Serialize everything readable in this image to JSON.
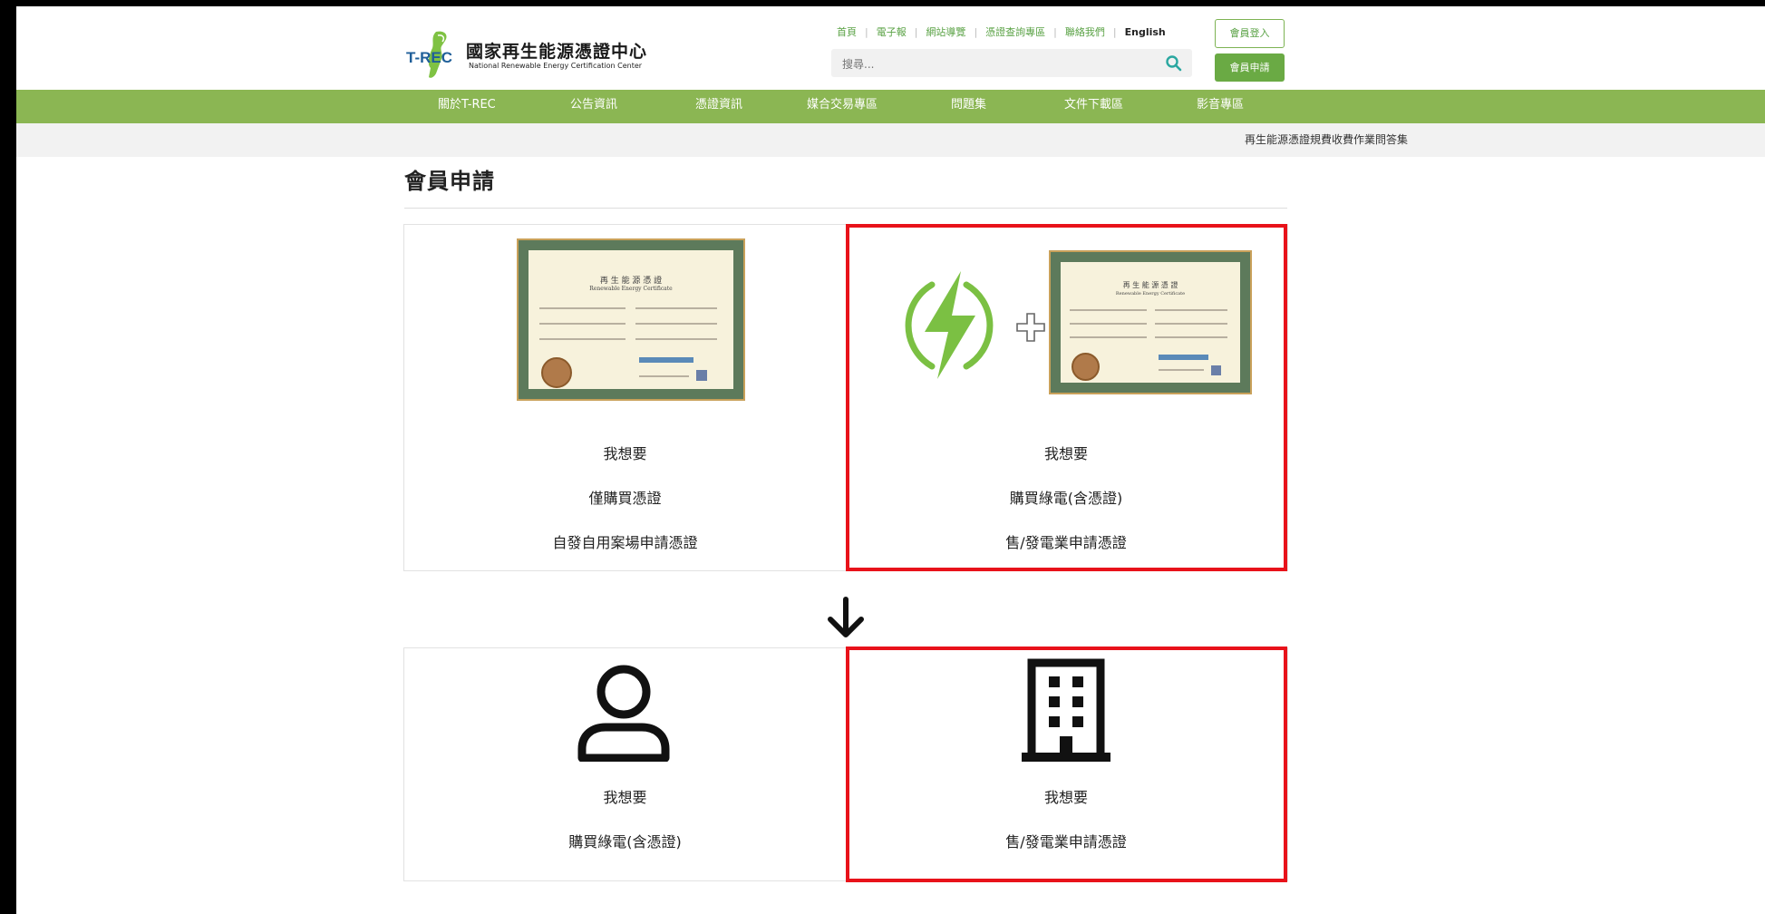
{
  "header": {
    "logo_mark": "T-REC",
    "logo_cn": "國家再生能源憑證中心",
    "logo_en": "National Renewable Energy Certification Center",
    "top_links": [
      "首頁",
      "電子報",
      "網站導覽",
      "憑證查詢專區",
      "聯絡我們"
    ],
    "lang_link": "English",
    "search_placeholder": "搜尋...",
    "login_label": "會員登入",
    "apply_label": "會員申請"
  },
  "nav": {
    "items": [
      "關於T-REC",
      "公告資訊",
      "憑證資訊",
      "媒合交易專區",
      "問題集",
      "文件下載區",
      "影音專區"
    ]
  },
  "marquee": "再生能源憑證規費收費作業問答集",
  "page_title": "會員申請",
  "certificate": {
    "title_cn": "再 生 能 源 憑 證",
    "title_en": "Renewable Energy Certificate"
  },
  "cards_top": [
    {
      "lines": [
        "我想要",
        "僅購買憑證",
        "自發自用案場申請憑證"
      ]
    },
    {
      "lines": [
        "我想要",
        "購買綠電(含憑證)",
        "售/發電業申請憑證"
      ]
    }
  ],
  "cards_bottom": [
    {
      "icon": "person-icon",
      "lines": [
        "我想要",
        "購買綠電(含憑證)"
      ]
    },
    {
      "icon": "building-icon",
      "lines": [
        "我想要",
        "售/發電業申請憑證"
      ]
    }
  ],
  "colors": {
    "brand_green": "#8bb653",
    "link_green": "#5aa245",
    "highlight_red": "#e8121a",
    "bolt_green": "#7bc043"
  }
}
